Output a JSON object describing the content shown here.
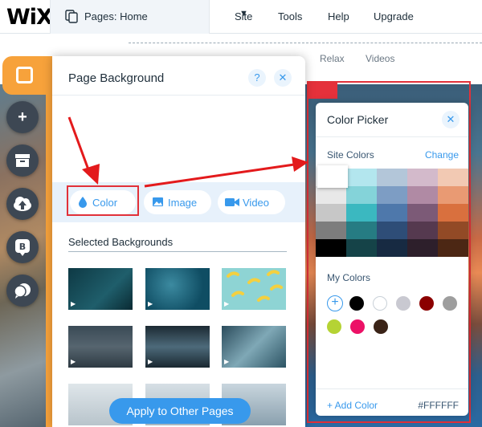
{
  "topbar": {
    "logo": "WiX",
    "pages_label": "Pages: Home",
    "menu": [
      "Site",
      "Tools",
      "Help",
      "Upgrade"
    ]
  },
  "site": {
    "nav": [
      "Relax",
      "Videos"
    ]
  },
  "rail": {
    "tools": [
      "background-icon",
      "add-icon",
      "store-icon",
      "upload-icon",
      "blog-icon",
      "chat-icon"
    ],
    "blog_letter": "B"
  },
  "background_panel": {
    "title": "Page Background",
    "help": "?",
    "close": "✕",
    "types": [
      {
        "label": "Color",
        "icon": "drop-icon"
      },
      {
        "label": "Image",
        "icon": "image-icon"
      },
      {
        "label": "Video",
        "icon": "video-camera-icon"
      }
    ],
    "selected_title": "Selected Backgrounds",
    "apply_label": "Apply to Other Pages"
  },
  "color_picker": {
    "title": "Color Picker",
    "close": "✕",
    "site_colors_label": "Site Colors",
    "change_label": "Change",
    "site_colors": [
      [
        "#ffffff",
        "#b3e6ee",
        "#b3c6d9",
        "#d3bacb",
        "#f2c9b3"
      ],
      [
        "#e8e8e8",
        "#84d3d9",
        "#7d9dc4",
        "#b08aa4",
        "#e99a73"
      ],
      [
        "#c7c7c7",
        "#3bb8c0",
        "#4e78ab",
        "#7c5a77",
        "#d9703e"
      ],
      [
        "#7d7d7d",
        "#267c83",
        "#2e4d77",
        "#55394f",
        "#924a26"
      ],
      [
        "#000000",
        "#154348",
        "#172a42",
        "#2d1f2b",
        "#4c2714"
      ]
    ],
    "my_colors_label": "My Colors",
    "my_colors": [
      "#000000",
      "#ffffff",
      "#c9c9d1",
      "#8b0000",
      "#9e9e9e",
      "#b5d334",
      "#ec1166",
      "#3a2317"
    ],
    "add_color_label": "+ Add Color",
    "hex_value": "#FFFFFF"
  }
}
